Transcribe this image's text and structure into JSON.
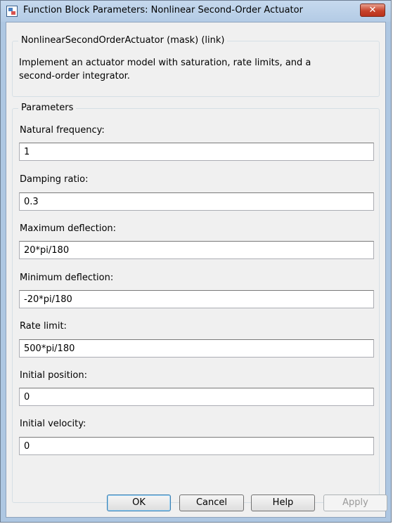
{
  "window": {
    "title": "Function Block Parameters: Nonlinear Second-Order Actuator",
    "close_label": "✕"
  },
  "mask": {
    "header": "NonlinearSecondOrderActuator (mask) (link)",
    "description": "Implement an actuator model with saturation, rate limits, and a second-order integrator."
  },
  "parameters": {
    "legend": "Parameters",
    "natural_frequency": {
      "label": "Natural frequency:",
      "value": "1"
    },
    "damping_ratio": {
      "label": "Damping ratio:",
      "value": "0.3"
    },
    "max_deflection": {
      "label": "Maximum deflection:",
      "value": "20*pi/180"
    },
    "min_deflection": {
      "label": "Minimum deflection:",
      "value": "-20*pi/180"
    },
    "rate_limit": {
      "label": "Rate limit:",
      "value": "500*pi/180"
    },
    "initial_position": {
      "label": "Initial position:",
      "value": "0"
    },
    "initial_velocity": {
      "label": "Initial velocity:",
      "value": "0"
    }
  },
  "buttons": {
    "ok": "OK",
    "cancel": "Cancel",
    "help": "Help",
    "apply": "Apply"
  }
}
